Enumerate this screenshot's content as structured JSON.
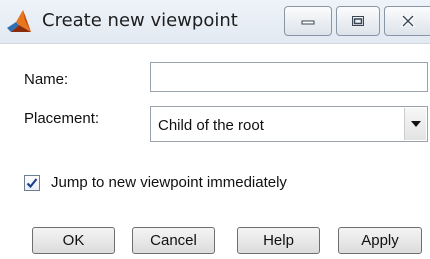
{
  "window": {
    "title": "Create new viewpoint",
    "icon": "matlab-logo-icon"
  },
  "title_buttons": {
    "minimize_icon": "minimize-icon",
    "maximize_icon": "maximize-icon",
    "close_icon": "close-icon"
  },
  "form": {
    "name_label": "Name:",
    "name_value": "",
    "placement_label": "Placement:",
    "placement_value": "Child of the root",
    "jump_label": "Jump to new viewpoint immediately",
    "jump_checked": true
  },
  "buttons": {
    "ok": "OK",
    "cancel": "Cancel",
    "help": "Help",
    "apply": "Apply"
  }
}
